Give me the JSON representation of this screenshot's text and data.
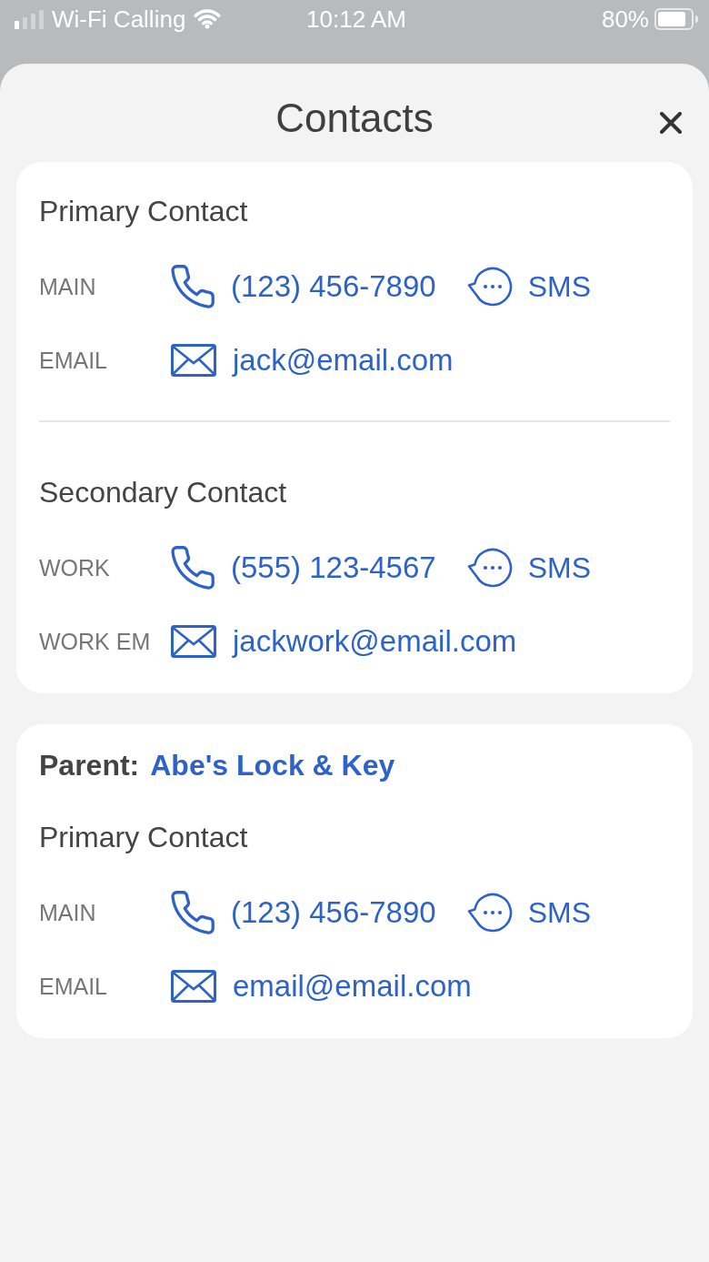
{
  "status_bar": {
    "carrier": "Wi-Fi Calling",
    "time": "10:12 AM",
    "battery": "80%"
  },
  "sheet": {
    "title": "Contacts"
  },
  "cards": [
    {
      "sections": [
        {
          "title": "Primary Contact",
          "rows": [
            {
              "kind": "phone",
              "label": "MAIN",
              "value": "(123) 456-7890",
              "sms": "SMS"
            },
            {
              "kind": "email",
              "label": "EMAIL",
              "value": "jack@email.com"
            }
          ]
        },
        {
          "title": "Secondary Contact",
          "rows": [
            {
              "kind": "phone",
              "label": "WORK",
              "value": "(555) 123-4567",
              "sms": "SMS"
            },
            {
              "kind": "email",
              "label": "WORK EM",
              "value": "jackwork@email.com"
            }
          ]
        }
      ]
    },
    {
      "parent": {
        "label": "Parent:",
        "name": "Abe's Lock & Key"
      },
      "sections": [
        {
          "title": "Primary Contact",
          "rows": [
            {
              "kind": "phone",
              "label": "MAIN",
              "value": "(123) 456-7890",
              "sms": "SMS"
            },
            {
              "kind": "email",
              "label": "EMAIL",
              "value": "email@email.com"
            }
          ]
        }
      ]
    }
  ]
}
